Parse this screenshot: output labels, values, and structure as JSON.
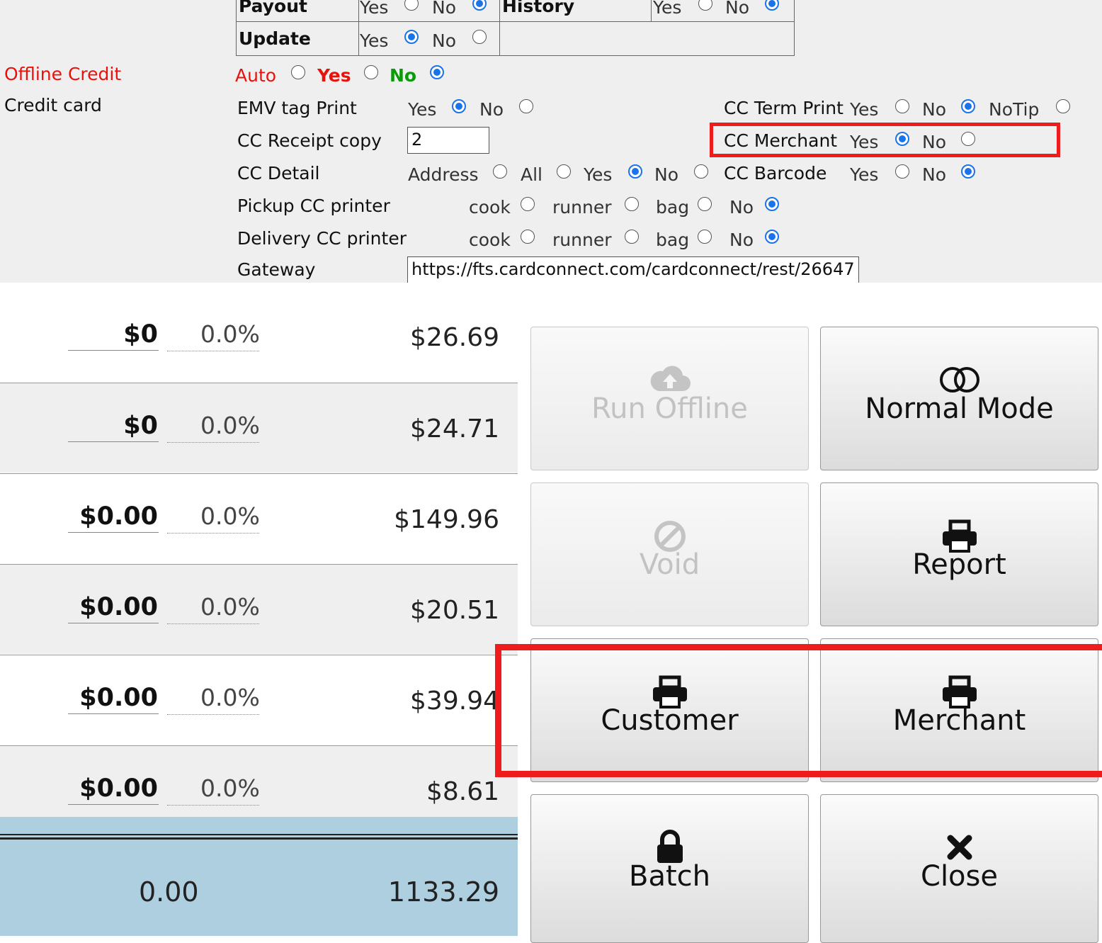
{
  "settings": {
    "payout_label": "Payout",
    "history_label": "History",
    "update_label": "Update",
    "offline_credit_label": "Offline Credit",
    "offline_auto": "Auto",
    "offline_yes": "Yes",
    "offline_no": "No",
    "credit_card_label": "Credit card",
    "emv_tag_print_label": "EMV tag Print",
    "cc_receipt_copy_label": "CC Receipt copy",
    "cc_receipt_copy_value": "2",
    "cc_detail_label": "CC Detail",
    "pickup_cc_printer_label": "Pickup CC printer",
    "delivery_cc_printer_label": "Delivery CC printer",
    "gateway_label": "Gateway",
    "gateway_value": "https://fts.cardconnect.com/cardconnect/rest/26647",
    "cc_term_print_label": "CC Term Print",
    "cc_merchant_label": "CC Merchant",
    "cc_barcode_label": "CC Barcode",
    "opt_yes": "Yes",
    "opt_no": "No",
    "opt_notip": "NoTip",
    "opt_address": "Address",
    "opt_all": "All",
    "opt_cook": "cook",
    "opt_runner": "runner",
    "opt_bag": "bag"
  },
  "list": {
    "rows": [
      {
        "amount": "$0",
        "percent": "0.0%",
        "total": "$26.69"
      },
      {
        "amount": "$0",
        "percent": "0.0%",
        "total": "$24.71"
      },
      {
        "amount": "$0.00",
        "percent": "0.0%",
        "total": "$149.96"
      },
      {
        "amount": "$0.00",
        "percent": "0.0%",
        "total": "$20.51"
      },
      {
        "amount": "$0.00",
        "percent": "0.0%",
        "total": "$39.94"
      },
      {
        "amount": "$0.00",
        "percent": "0.0%",
        "total": "$8.61"
      }
    ],
    "totals": {
      "amount": "0.00",
      "total": "1133.29"
    }
  },
  "buttons": {
    "run_offline": {
      "label": "Run Offline",
      "icon": "cloud-upload-icon"
    },
    "normal_mode": {
      "label": "Normal Mode",
      "icon": "toggle-icon"
    },
    "void": {
      "label": "Void",
      "icon": "ban-icon"
    },
    "report": {
      "label": "Report",
      "icon": "printer-icon"
    },
    "customer": {
      "label": "Customer",
      "icon": "printer-icon"
    },
    "merchant": {
      "label": "Merchant",
      "icon": "printer-icon"
    },
    "batch": {
      "label": "Batch",
      "icon": "lock-icon"
    },
    "close": {
      "label": "Close",
      "icon": "close-icon"
    }
  },
  "colors": {
    "highlight": "#ee1c1c",
    "radio_selected": "#1a73e8",
    "totals_bg": "#aecfdf",
    "offline_label": "#e8120c"
  }
}
